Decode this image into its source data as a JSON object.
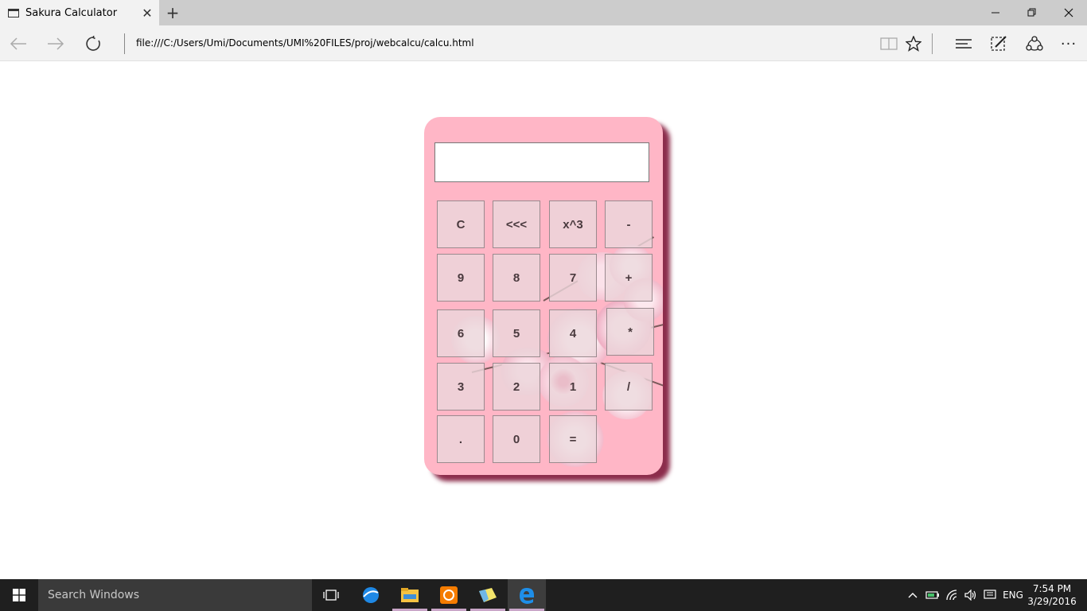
{
  "browser": {
    "tab_title": "Sakura Calculator",
    "tab_close": "✕",
    "new_tab": "+",
    "address": "file:///C:/Users/Umi/Documents/UMI%20FILES/proj/webcalcu/calcu.html",
    "more": "···"
  },
  "calculator": {
    "display_value": "",
    "keys": {
      "clear": "C",
      "backspace": "<<<",
      "cube": "x^3",
      "minus": "-",
      "nine": "9",
      "eight": "8",
      "seven": "7",
      "plus": "+",
      "six": "6",
      "five": "5",
      "four": "4",
      "multiply": "*",
      "three": "3",
      "two": "2",
      "one": "1",
      "divide": "/",
      "dot": ".",
      "zero": "0",
      "equals": "="
    }
  },
  "taskbar": {
    "search_placeholder": "Search Windows",
    "language": "ENG",
    "time": "7:54 PM",
    "date": "3/29/2016"
  },
  "colors": {
    "calculator_body": "#ffb6c6",
    "calculator_shadow": "#8c2d4c",
    "key_face": "#ebd6da",
    "taskbar": "#1f1f1f"
  }
}
